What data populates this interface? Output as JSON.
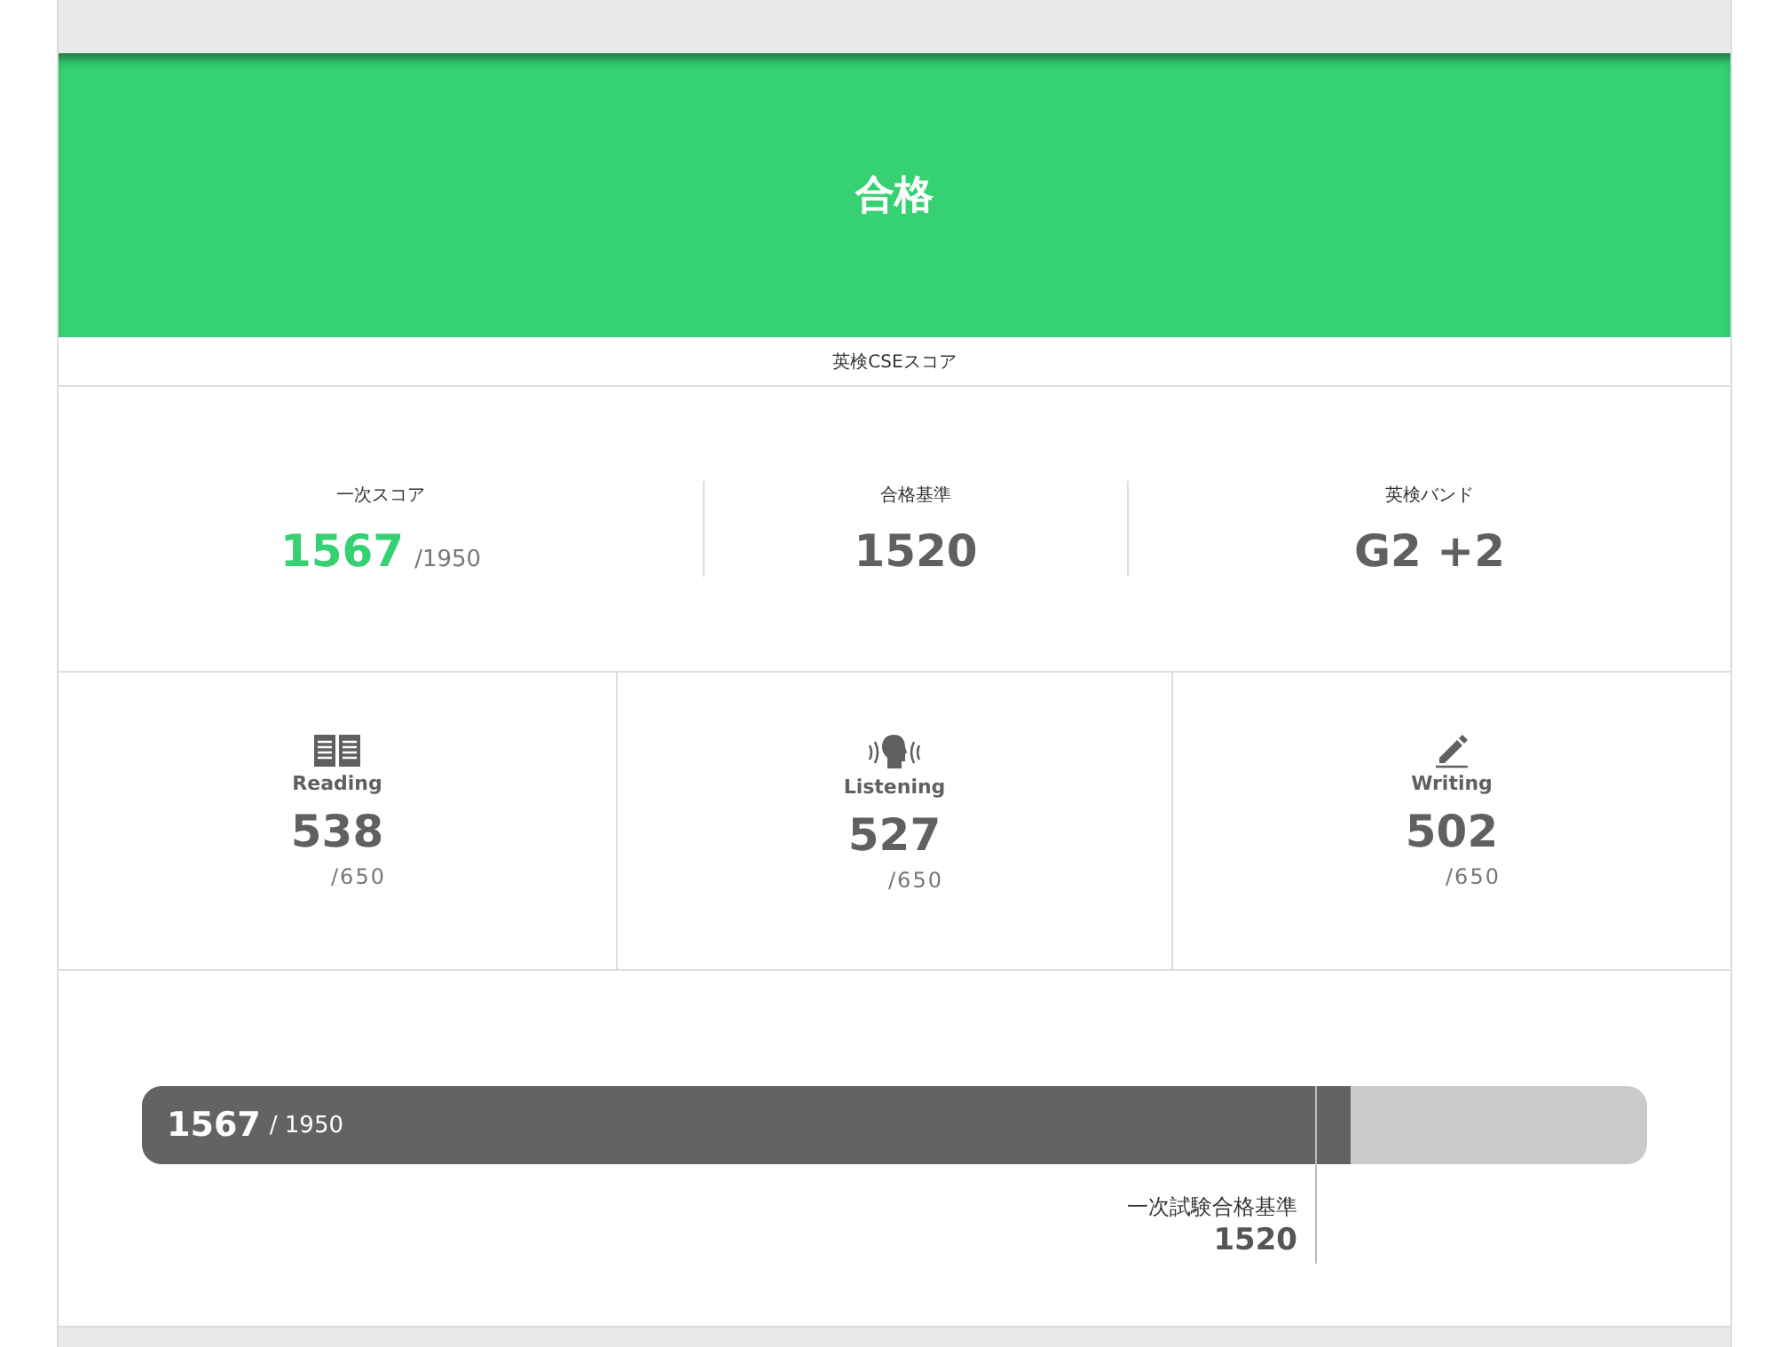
{
  "result": {
    "title": "合格"
  },
  "caption": "英検CSEスコア",
  "summary": [
    {
      "label": "一次スコア",
      "value": "1567",
      "total": "/1950",
      "kind": "score"
    },
    {
      "label": "合格基準",
      "value": "1520",
      "kind": "plain"
    },
    {
      "label": "英検バンド",
      "value": "G2 +2",
      "kind": "plain"
    }
  ],
  "skills": [
    {
      "kind": "reading",
      "label": "Reading",
      "value": "538",
      "total": "/650"
    },
    {
      "kind": "listening",
      "label": "Listening",
      "value": "527",
      "total": "/650"
    },
    {
      "kind": "writing",
      "label": "Writing",
      "value": "502",
      "total": "/650"
    }
  ],
  "bar": {
    "value": "1567",
    "total": "/ 1950",
    "level": 0.8036,
    "marker": {
      "label": "一次試験合格基準",
      "value": "1520",
      "level": 0.7795
    }
  }
}
